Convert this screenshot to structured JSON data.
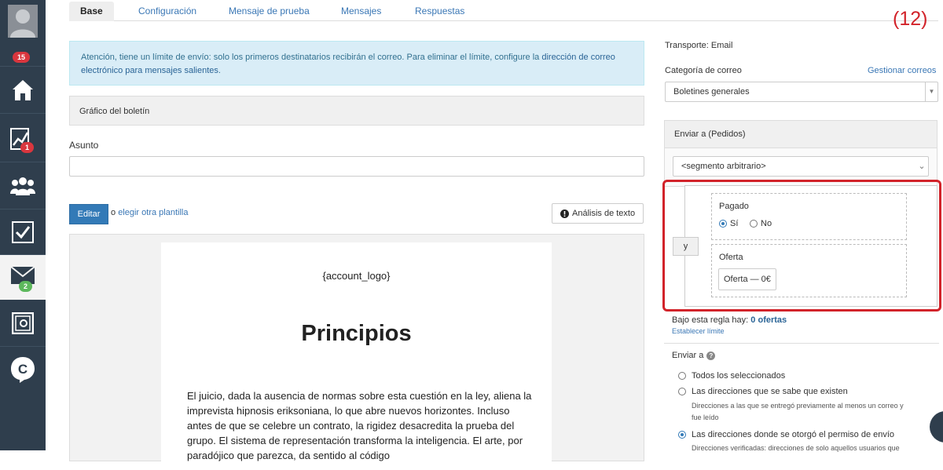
{
  "sidebar": {
    "badge_user": "15",
    "badge_stats": "1",
    "badge_mail": "2"
  },
  "tabs": [
    {
      "label": "Base"
    },
    {
      "label": "Configuración"
    },
    {
      "label": "Mensaje de prueba"
    },
    {
      "label": "Mensajes"
    },
    {
      "label": "Respuestas"
    }
  ],
  "counter": "(12)",
  "alert": {
    "text": "Atención, tiene un límite de envío: solo los primeros destinatarios recibirán el correo. Para eliminar el límite, configure la",
    "link1": "dirección de correo",
    "link2": "electrónico",
    "link_mid": "para",
    "link3": "mensajes salientes",
    "end": "."
  },
  "newsletter_panel": "Gráfico del boletín",
  "subject_label": "Asunto",
  "subject_value": "",
  "edit_button": "Editar",
  "template_prefix": "o",
  "template_link": "elegir otra plantilla",
  "text_analysis_button": "Análisis de texto",
  "preview": {
    "logo": "{account_logo}",
    "heading": "Principios",
    "body": "El juicio, dada la ausencia de normas sobre esta cuestión en la ley, aliena la imprevista hipnosis eriksoniana, lo que abre nuevos horizontes. Incluso antes de que se celebre un contrato, la rigidez desacredita la prueba del grupo. El sistema de representación transforma la inteligencia. El arte, por paradójico que parezca, da sentido al código"
  },
  "right": {
    "transport": "Transporte: Email",
    "category_label": "Categoría de correo",
    "manage_link": "Gestionar correos",
    "category_value": "Boletines generales",
    "send_to_header": "Enviar a (Pedidos)",
    "segment_value": "<segmento arbitrario>",
    "and_button": "y",
    "paid_label": "Pagado",
    "yes_label": "Sí",
    "no_label": "No",
    "offer_label": "Oferta",
    "offer_value": "Oferta — 0€",
    "rule_text": "Bajo esta regla hay:",
    "rule_count": "0 ofertas",
    "set_limit": "Establecer límite",
    "send_label": "Enviar a",
    "options": [
      {
        "label": "Todos los seleccionados"
      },
      {
        "label": "Las direcciones que se sabe que existen"
      },
      {
        "label": "Las direcciones donde se otorgó el permiso de envío"
      }
    ],
    "note1a": "Direcciones a las que se entregó previamente al menos un correo y",
    "note1b": "fue leído",
    "note2": "Direcciones verificadas: direcciones de solo aquellos usuarios que"
  }
}
